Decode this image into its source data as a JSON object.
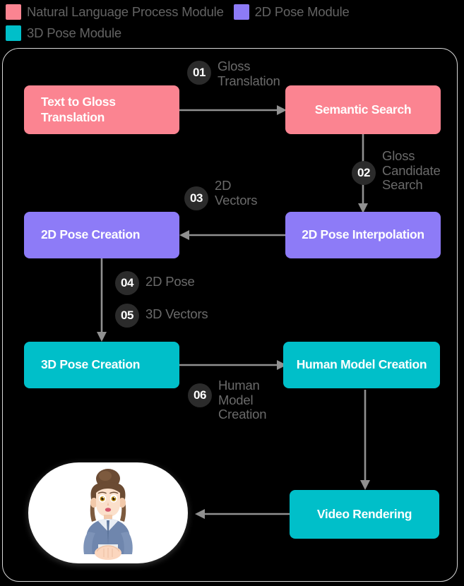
{
  "legend": {
    "items": [
      {
        "label": "Natural Language Process Module",
        "color": "#fb8491"
      },
      {
        "label": "2D Pose Module",
        "color": "#8d7bf7"
      },
      {
        "label": "3D Pose Module",
        "color": "#00bfc9"
      }
    ]
  },
  "diagram": {
    "nodes": [
      {
        "id": "text-to-gloss-translation",
        "label": "Text to Gloss Translation",
        "color": "#fb8491",
        "module": "Natural Language Process Module"
      },
      {
        "id": "semantic-search",
        "label": "Semantic Search",
        "color": "#fb8491",
        "module": "Natural Language Process Module"
      },
      {
        "id": "2d-pose-creation",
        "label": "2D Pose Creation",
        "color": "#8d7bf7",
        "module": "2D Pose Module"
      },
      {
        "id": "2d-pose-interpolation",
        "label": "2D Pose Interpolation",
        "color": "#8d7bf7",
        "module": "2D Pose Module"
      },
      {
        "id": "3d-pose-creation",
        "label": "3D Pose Creation",
        "color": "#00bfc9",
        "module": "3D Pose Module"
      },
      {
        "id": "human-model-creation",
        "label": "Human Model Creation",
        "color": "#00bfc9",
        "module": "3D Pose Module"
      },
      {
        "id": "video-rendering",
        "label": "Video Rendering",
        "color": "#00bfc9",
        "module": "3D Pose Module"
      }
    ],
    "steps": [
      {
        "number": "01",
        "label": "Gloss Translation",
        "from": "text-to-gloss-translation",
        "to": "semantic-search"
      },
      {
        "number": "02",
        "label": "Gloss Candidate Search",
        "from": "semantic-search",
        "to": "2d-pose-interpolation"
      },
      {
        "number": "03",
        "label": "2D Vectors",
        "from": "2d-pose-interpolation",
        "to": "2d-pose-creation"
      },
      {
        "number": "04",
        "label": "2D Pose",
        "from": "2d-pose-creation",
        "to": "3d-pose-creation"
      },
      {
        "number": "05",
        "label": "3D Vectors",
        "from": "2d-pose-creation",
        "to": "3d-pose-creation"
      },
      {
        "number": "06",
        "label": "Human Model Creation",
        "from": "3d-pose-creation",
        "to": "human-model-creation"
      }
    ],
    "output": {
      "id": "avatar-output",
      "alt": "3D signing avatar"
    }
  }
}
